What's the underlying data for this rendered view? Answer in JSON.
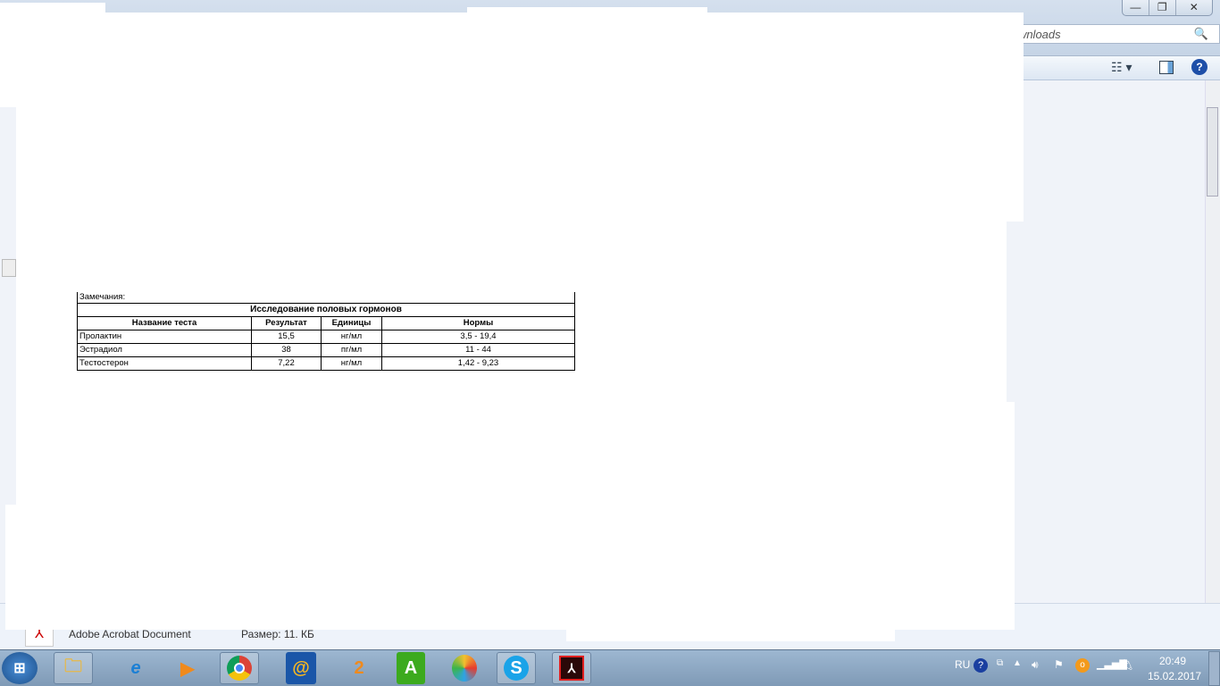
{
  "window": {
    "search_placeholder": "оиск: Downloads",
    "min": "—",
    "max": "❐",
    "close": "✕"
  },
  "toolbar": {
    "views_icon": "details-view-icon",
    "preview_icon": "preview-pane-icon",
    "help_icon": "help-icon"
  },
  "document": {
    "remarks_label": "Замечания:",
    "section_title": "Исследование половых гормонов",
    "headers": [
      "Название теста",
      "Результат",
      "Единицы",
      "Нормы"
    ],
    "rows": [
      [
        "Пролактин",
        "15,5",
        "нг/мл",
        "3,5 - 19,4"
      ],
      [
        "Эстрадиол",
        "38",
        "пг/мл",
        "11 - 44"
      ],
      [
        "Тестостерон",
        "7,22",
        "нг/мл",
        "1,42 - 9,23"
      ]
    ]
  },
  "status_bar": {
    "file_type": "Adobe Acrobat Document",
    "size_label": "Размер: 11. КБ"
  },
  "taskbar": {
    "apps": [
      "Windows Explorer",
      "Internet Explorer",
      "Media Player",
      "Google Chrome",
      "Mail.ru Agent",
      "2GIS",
      "Amigo A",
      "Amigo Browser",
      "Skype",
      "Adobe Acrobat"
    ],
    "tray": {
      "language": "RU",
      "time": "20:49",
      "date": "15.02.2017"
    }
  }
}
